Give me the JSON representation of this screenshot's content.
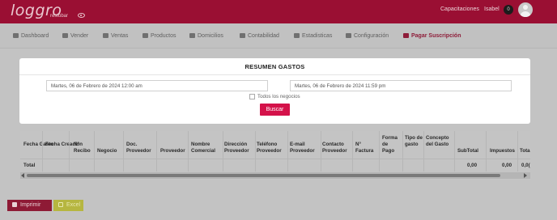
{
  "header": {
    "logo": "loggro",
    "logo_sub": "restobar",
    "capacitaciones": "Capacitaciones",
    "user": "Isabel",
    "notifications": "0"
  },
  "nav": [
    {
      "label": "Dashboard",
      "icon": "dashboard-icon"
    },
    {
      "label": "Vender",
      "icon": "cart-icon"
    },
    {
      "label": "Ventas",
      "icon": "tags-icon"
    },
    {
      "label": "Productos",
      "icon": "basket-icon"
    },
    {
      "label": "Domicilios",
      "icon": "motorcycle-icon"
    },
    {
      "label": "Contabilidad",
      "icon": "calculator-icon"
    },
    {
      "label": "Estadisticas",
      "icon": "chart-line-icon"
    },
    {
      "label": "Configuración",
      "icon": "gear-icon"
    },
    {
      "label": "Pagar Suscripción",
      "icon": "credit-card-icon",
      "active": true
    }
  ],
  "modal": {
    "title": "RESUMEN GASTOS",
    "date_from": "Martes, 06 de Febrero de 2024 12:00 am",
    "date_to": "Martes, 06 de Febrero de 2024 11:59 pm",
    "all_business_label": "Todos los negocios",
    "search_button": "Buscar"
  },
  "table": {
    "headers": [
      "Fecha Gasto",
      "Fecha Creación",
      "N° Recibo",
      "Negocio",
      "Doc. Proveedor",
      "Proveedor",
      "Nombre Comercial",
      "Dirección Proveedor",
      "Teléfono Proveedor",
      "E-mail Proveedor",
      "Contacto Proveedor",
      "N° Factura",
      "Forma de Pago",
      "Tipo de gasto",
      "Concepto del Gasto",
      "SubTotal",
      "Impuestos",
      "Tota"
    ],
    "total_label": "Total",
    "totals": [
      "0,00",
      "0,00",
      "0,0("
    ]
  },
  "footer": {
    "print_label": "Imprimir",
    "excel_label": "Excel"
  },
  "colors": {
    "brand": "#9a0f33",
    "accent": "#d4124a",
    "excel": "#b6b640"
  }
}
